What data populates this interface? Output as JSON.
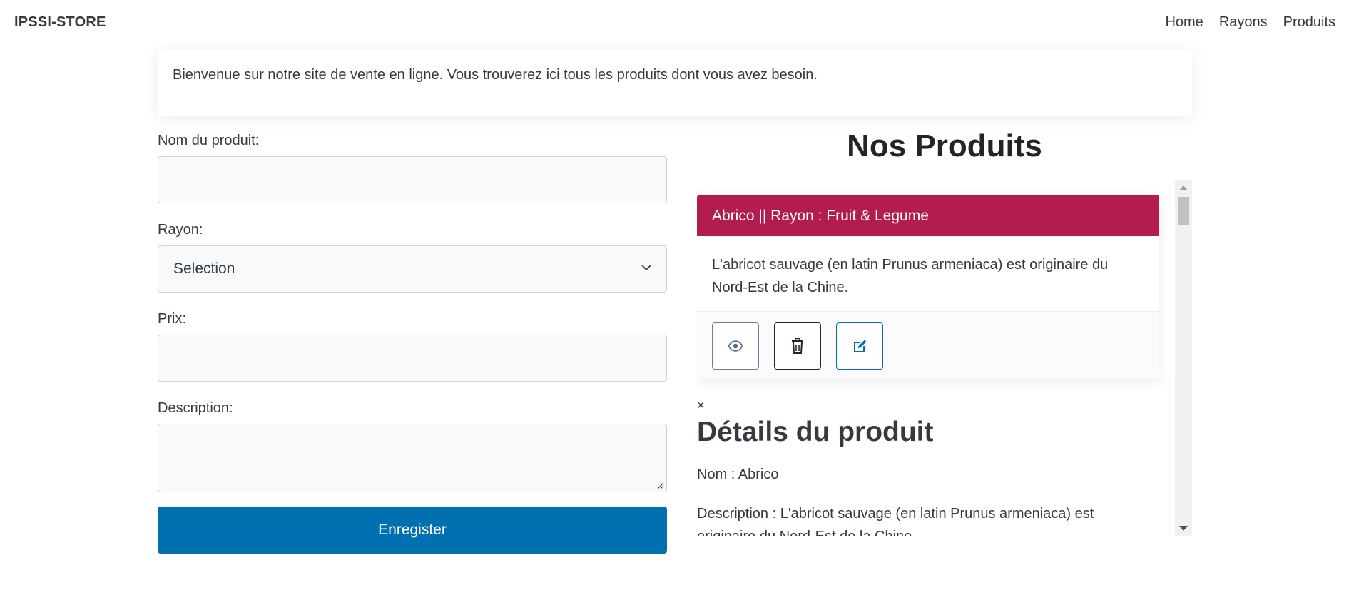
{
  "navbar": {
    "brand": "IPSSI-STORE",
    "links": [
      "Home",
      "Rayons",
      "Produits"
    ]
  },
  "welcome": {
    "text": "Bienvenue sur notre site de vente en ligne. Vous trouverez ici tous les produits dont vous avez besoin."
  },
  "form": {
    "name_label": "Nom du produit:",
    "name_value": "",
    "rayon_label": "Rayon:",
    "rayon_selected": "Selection",
    "price_label": "Prix:",
    "price_value": "",
    "description_label": "Description:",
    "description_value": "",
    "submit_label": "Enregister"
  },
  "products": {
    "title": "Nos Produits",
    "items": [
      {
        "header": "Abrico || Rayon : Fruit & Legume",
        "description": "L'abricot sauvage (en latin Prunus armeniaca) est originaire du Nord-Est de la Chine.",
        "actions": [
          "eye-icon",
          "trash-icon",
          "edit-icon"
        ]
      }
    ]
  },
  "details": {
    "close": "×",
    "title": "Détails du produit",
    "name": "Nom : Abrico",
    "description": "Description : L'abricot sauvage (en latin Prunus armeniaca) est originaire du Nord-Est de la Chine."
  },
  "colors": {
    "primary": "#0070b0",
    "card_header": "#b31c4e",
    "text": "#343a40"
  }
}
